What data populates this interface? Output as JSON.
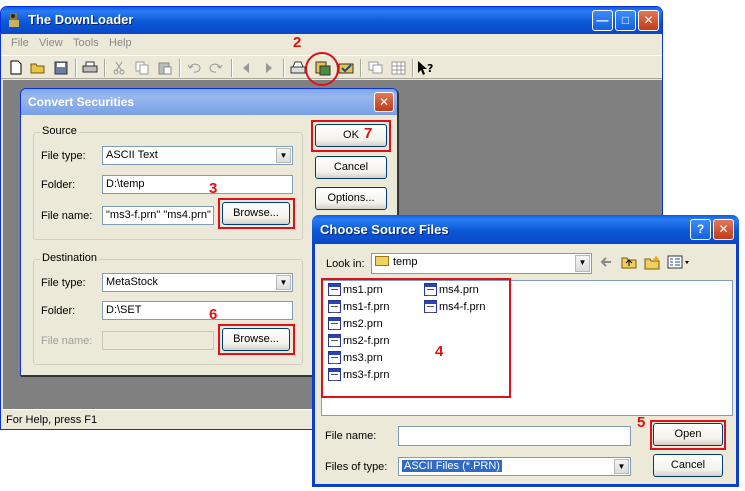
{
  "main_window": {
    "title": "The DownLoader",
    "caption_buttons": [
      "minimize",
      "maximize",
      "close"
    ],
    "menu": [
      "File",
      "View",
      "Tools",
      "Help"
    ],
    "toolbar_icons": [
      "new-file-icon",
      "open-folder-icon",
      "save-icon",
      "print-icon",
      "cut-icon",
      "copy-icon",
      "paste-icon",
      "undo-icon",
      "redo-icon",
      "back-arrow-icon",
      "forward-arrow-icon",
      "download-icon",
      "convert-icon",
      "check-icon",
      "window-icon",
      "grid-icon",
      "context-help-icon"
    ],
    "status_text": "For Help, press F1"
  },
  "annotations": {
    "step_2": "2",
    "step_3": "3",
    "step_4": "4",
    "step_5": "5",
    "step_6": "6",
    "step_7": "7",
    "color": "#e0101a"
  },
  "convert_dialog": {
    "title": "Convert Securities",
    "source": {
      "legend": "Source",
      "file_type_label": "File type:",
      "file_type_value": "ASCII Text",
      "folder_label": "Folder:",
      "folder_value": "D:\\temp",
      "file_name_label": "File name:",
      "file_name_value": "\"ms3-f.prn\" \"ms4.prn\"",
      "browse_label": "Browse..."
    },
    "destination": {
      "legend": "Destination",
      "file_type_label": "File type:",
      "file_type_value": "MetaStock",
      "folder_label": "Folder:",
      "folder_value": "D:\\SET",
      "file_name_label": "File name:",
      "file_name_value": "",
      "browse_label": "Browse..."
    },
    "ok_label": "OK",
    "cancel_label": "Cancel",
    "options_label": "Options..."
  },
  "choose_dialog": {
    "title": "Choose Source Files",
    "help_button": "?",
    "look_in_label": "Look in:",
    "look_in_value": "temp",
    "files_col1": [
      "ms1.prn",
      "ms1-f.prn",
      "ms2.prn",
      "ms2-f.prn",
      "ms3.prn",
      "ms3-f.prn"
    ],
    "files_col2": [
      "ms4.prn",
      "ms4-f.prn"
    ],
    "file_name_label": "File name:",
    "file_name_value": "",
    "files_of_type_label": "Files of type:",
    "files_of_type_value": "ASCII Files (*.PRN)",
    "open_label": "Open",
    "cancel_label": "Cancel"
  }
}
